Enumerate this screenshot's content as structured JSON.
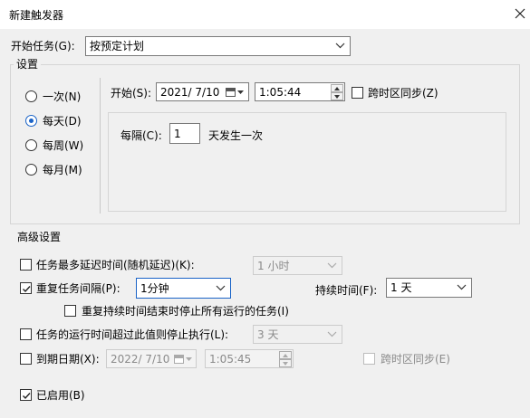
{
  "window": {
    "title": "新建触发器"
  },
  "begin_task": {
    "label": "开始任务(G):",
    "value": "按预定计划"
  },
  "settings": {
    "group_label": "设置",
    "schedule_options": [
      {
        "label": "一次(N)",
        "selected": false
      },
      {
        "label": "每天(D)",
        "selected": true
      },
      {
        "label": "每周(W)",
        "selected": false
      },
      {
        "label": "每月(M)",
        "selected": false
      }
    ],
    "start_label": "开始(S):",
    "start_date": "2021/ 7/10",
    "start_time": "1:05:44",
    "sync_timezone_label": "跨时区同步(Z)",
    "recur_label": "每隔(C):",
    "recur_value": "1",
    "recur_suffix": "天发生一次"
  },
  "advanced": {
    "group_label": "高级设置",
    "delay": {
      "label": "任务最多延迟时间(随机延迟)(K):",
      "value": "1 小时",
      "checked": false
    },
    "repeat": {
      "label": "重复任务间隔(P):",
      "value": "1分钟",
      "checked": true
    },
    "duration": {
      "label": "持续时间(F):",
      "value": "1 天"
    },
    "stop_at_end": {
      "label": "重复持续时间结束时停止所有运行的任务(I)",
      "checked": false
    },
    "stop_if_longer": {
      "label": "任务的运行时间超过此值则停止执行(L):",
      "value": "3 天",
      "checked": false
    },
    "expire": {
      "label": "到期日期(X):",
      "date": "2022/ 7/10",
      "time": "1:05:45",
      "sync_label": "跨时区同步(E)",
      "checked": false
    },
    "enabled": {
      "label": "已启用(B)",
      "checked": true
    }
  },
  "colors": {
    "accent": "#1a63c7",
    "background": "#f0f0f0"
  }
}
